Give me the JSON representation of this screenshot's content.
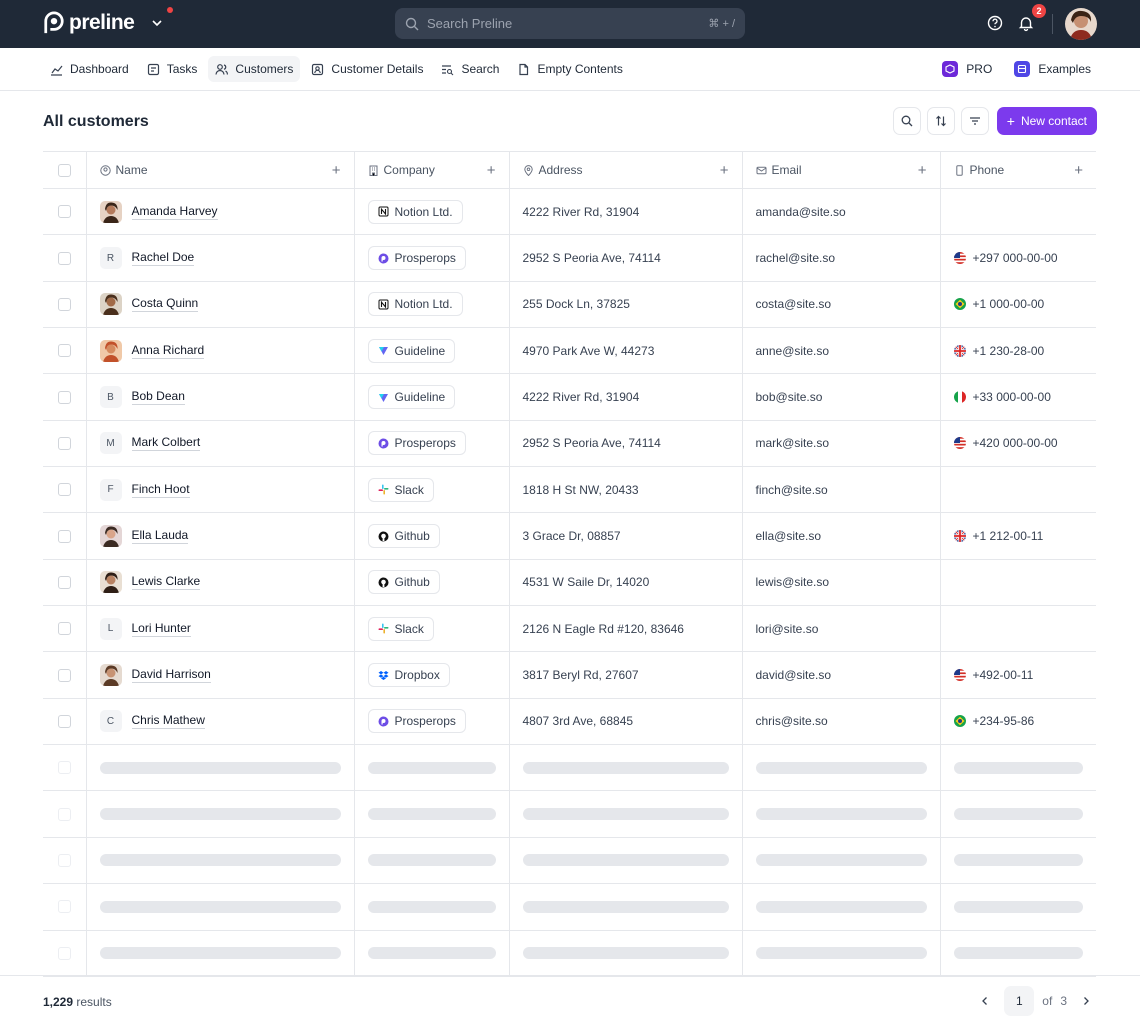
{
  "topbar": {
    "brand": "preline",
    "search_placeholder": "Search Preline",
    "search_shortcut": "⌘ + /",
    "notifications_count": "2"
  },
  "nav": {
    "items": [
      {
        "label": "Dashboard",
        "icon": "chart-icon"
      },
      {
        "label": "Tasks",
        "icon": "task-icon"
      },
      {
        "label": "Customers",
        "icon": "users-icon"
      },
      {
        "label": "Customer Details",
        "icon": "user-card-icon"
      },
      {
        "label": "Search",
        "icon": "search-list-icon"
      },
      {
        "label": "Empty Contents",
        "icon": "file-icon"
      }
    ],
    "pro_label": "PRO",
    "examples_label": "Examples"
  },
  "page": {
    "title": "All customers",
    "new_contact_label": "New contact"
  },
  "table": {
    "columns": [
      "Name",
      "Company",
      "Address",
      "Email",
      "Phone"
    ],
    "rows": [
      {
        "name": "Amanda Harvey",
        "avatar": "photo",
        "initial": "",
        "company": "Notion Ltd.",
        "company_icon": "notion-icon",
        "address": "4222 River Rd, 31904",
        "email": "amanda@site.so",
        "phone": "",
        "flag": ""
      },
      {
        "name": "Rachel Doe",
        "avatar": "letter",
        "initial": "R",
        "company": "Prosperops",
        "company_icon": "prosperops-icon",
        "address": "2952 S Peoria Ave, 74114",
        "email": "rachel@site.so",
        "phone": "+297 000-00-00",
        "flag": "us-flag"
      },
      {
        "name": "Costa Quinn",
        "avatar": "photo",
        "initial": "",
        "company": "Notion Ltd.",
        "company_icon": "notion-icon",
        "address": "255 Dock Ln, 37825",
        "email": "costa@site.so",
        "phone": "+1 000-00-00",
        "flag": "br-flag"
      },
      {
        "name": "Anna Richard",
        "avatar": "photo",
        "initial": "",
        "company": "Guideline",
        "company_icon": "guideline-icon",
        "address": "4970 Park Ave W, 44273",
        "email": "anne@site.so",
        "phone": "+1 230-28-00",
        "flag": "uk-flag"
      },
      {
        "name": "Bob Dean",
        "avatar": "letter",
        "initial": "B",
        "company": "Guideline",
        "company_icon": "guideline-icon",
        "address": "4222 River Rd, 31904",
        "email": "bob@site.so",
        "phone": "+33 000-00-00",
        "flag": "it-flag"
      },
      {
        "name": "Mark Colbert",
        "avatar": "letter",
        "initial": "M",
        "company": "Prosperops",
        "company_icon": "prosperops-icon",
        "address": "2952 S Peoria Ave, 74114",
        "email": "mark@site.so",
        "phone": "+420 000-00-00",
        "flag": "us-flag"
      },
      {
        "name": "Finch Hoot",
        "avatar": "letter",
        "initial": "F",
        "company": "Slack",
        "company_icon": "slack-icon",
        "address": "1818 H St NW, 20433",
        "email": "finch@site.so",
        "phone": "",
        "flag": ""
      },
      {
        "name": "Ella Lauda",
        "avatar": "photo",
        "initial": "",
        "company": "Github",
        "company_icon": "github-icon",
        "address": "3 Grace Dr, 08857",
        "email": "ella@site.so",
        "phone": "+1 212-00-11",
        "flag": "uk-flag"
      },
      {
        "name": "Lewis Clarke",
        "avatar": "photo",
        "initial": "",
        "company": "Github",
        "company_icon": "github-icon",
        "address": "4531 W Saile Dr, 14020",
        "email": "lewis@site.so",
        "phone": "",
        "flag": ""
      },
      {
        "name": "Lori Hunter",
        "avatar": "letter",
        "initial": "L",
        "company": "Slack",
        "company_icon": "slack-icon",
        "address": "2126 N Eagle Rd #120, 83646",
        "email": "lori@site.so",
        "phone": "",
        "flag": ""
      },
      {
        "name": "David Harrison",
        "avatar": "photo",
        "initial": "",
        "company": "Dropbox",
        "company_icon": "dropbox-icon",
        "address": "3817 Beryl Rd, 27607",
        "email": "david@site.so",
        "phone": "+492-00-11",
        "flag": "us-flag"
      },
      {
        "name": "Chris Mathew",
        "avatar": "letter",
        "initial": "C",
        "company": "Prosperops",
        "company_icon": "prosperops-icon",
        "address": "4807 3rd Ave, 68845",
        "email": "chris@site.so",
        "phone": "+234-95-86",
        "flag": "br-flag"
      }
    ],
    "skeleton_rows": 5
  },
  "footer": {
    "results_count": "1,229",
    "results_label": "results",
    "current_page": "1",
    "of_label": "of",
    "total_pages": "3"
  },
  "colors": {
    "topbar_bg": "#1f2937",
    "accent": "#7c3aed",
    "badge": "#ef4444"
  }
}
